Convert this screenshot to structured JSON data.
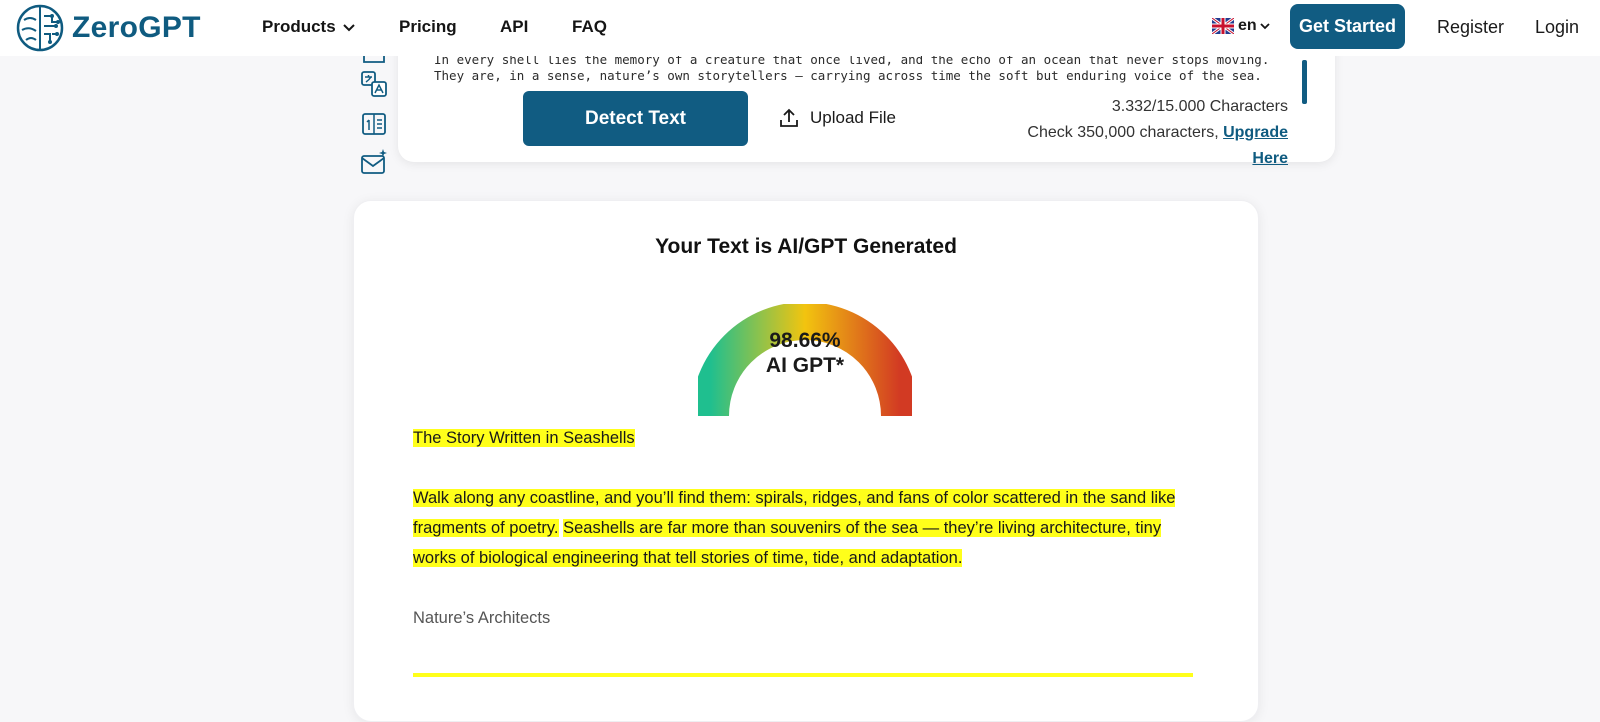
{
  "header": {
    "logo_text": "ZeroGPT",
    "nav": {
      "products": "Products",
      "pricing": "Pricing",
      "api": "API",
      "faq": "FAQ"
    },
    "language": "en",
    "get_started": "Get Started",
    "register": "Register",
    "login": "Login"
  },
  "side_tools": [
    "file-icon",
    "translate-icon",
    "word-counter-icon",
    "email-sparkle-icon"
  ],
  "input_card": {
    "text_line_1": "In every shell lies the memory of a creature that once lived, and the echo of an ocean that never stops moving.",
    "text_line_2": "They are, in a sense, nature’s own storytellers — carrying across time the soft but enduring voice of the sea.",
    "detect_button": "Detect Text",
    "upload_button": "Upload File",
    "char_count": "3.332/15.000 Characters",
    "upgrade_prefix": "Check 350,000 characters,",
    "upgrade_link": "Upgrade Here"
  },
  "result": {
    "title": "Your Text is AI/GPT Generated",
    "percentage": "98.66%",
    "percentage_value": 98.66,
    "label": "AI GPT*",
    "heading": "The Story Written in Seashells",
    "p1_s1": "Walk along any coastline, and you’ll find them: spirals, ridges, and fans of color scattered in the sand like fragments of poetry.",
    "p1_s2": "Seashells are far more than souvenirs of the sea — they’re living architecture, tiny works of biological engineering that tell stories of time, tide, and adaptation.",
    "subheading": "Nature’s Architects"
  },
  "colors": {
    "brand": "#115c82",
    "highlight": "#ffff1a",
    "gauge_start": "#1fbf8f",
    "gauge_mid": "#f2c40f",
    "gauge_end": "#d23a23"
  }
}
